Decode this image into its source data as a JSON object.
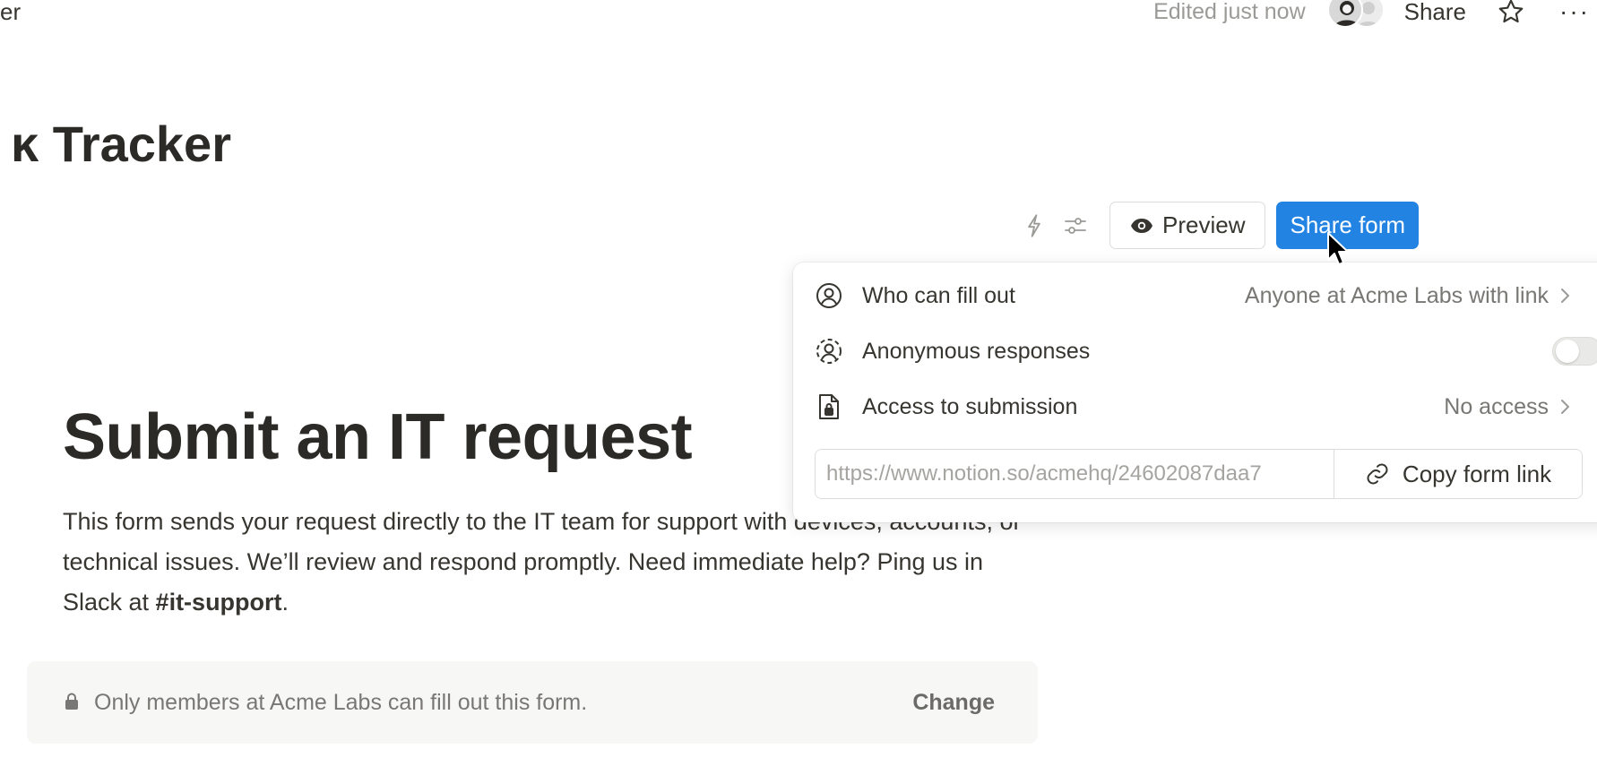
{
  "topbar": {
    "breadcrumb_fragment": "er",
    "edited_status": "Edited just now",
    "share_label": "Share",
    "more_label": "···"
  },
  "database": {
    "title": "ĸ Tracker"
  },
  "toolbar": {
    "preview_label": "Preview",
    "share_form_label": "Share form"
  },
  "share_popover": {
    "rows": [
      {
        "label": "Who can fill out",
        "value": "Anyone at Acme Labs with link"
      },
      {
        "label": "Anonymous responses",
        "toggle_on": false
      },
      {
        "label": "Access to submission",
        "value": "No access"
      }
    ],
    "link_url": "https://www.notion.so/acmehq/24602087daa7",
    "copy_label": "Copy form link"
  },
  "form": {
    "title": "Submit an IT request",
    "description_prefix": "This form sends your request directly to the IT team for support with devices, accounts, or technical issues. We’ll review and respond promptly. Need immediate help? Ping us in Slack at ",
    "description_channel": "#it-support",
    "description_suffix": "."
  },
  "notice": {
    "text": "Only members at Acme Labs can fill out this form.",
    "change_label": "Change"
  },
  "colors": {
    "accent": "#2383e2",
    "text": "#37352f",
    "muted": "#787774"
  }
}
